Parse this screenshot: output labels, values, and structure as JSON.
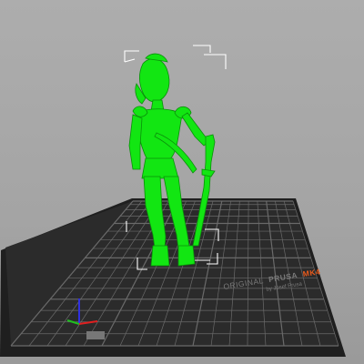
{
  "viewport": {
    "background_color": "#a9a9a9",
    "bed_color": "#2b2b2b",
    "bed_grid_color": "#6a6a6a",
    "model_color": "#12e612",
    "model_shadow_color": "#0a8f0a",
    "bounding_box_color": "#ffffff"
  },
  "bed_logo": {
    "line1_part1": "ORIGINAL",
    "line1_part2": "PRUSA",
    "line1_part3": "MK4",
    "line2": "by Josef Prusa",
    "accent_color": "#e85a1c",
    "text_color": "#7a7a7a"
  },
  "axes": {
    "x_color": "#e02020",
    "y_color": "#20c020",
    "z_color": "#3030e0"
  },
  "model": {
    "name": "figure-with-sword"
  }
}
